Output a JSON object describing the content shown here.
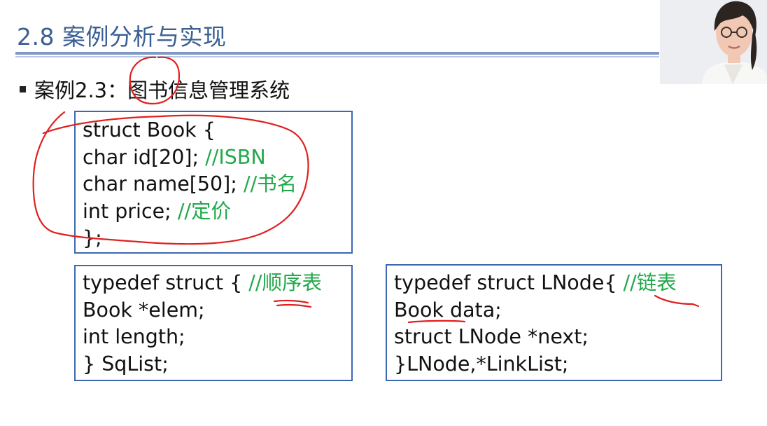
{
  "slide": {
    "title": "2.8 案例分析与实现",
    "bullet": "案例2.3：图书信息管理系统"
  },
  "code_boxes": {
    "book": {
      "lines": [
        {
          "code": "struct Book {",
          "comment": ""
        },
        {
          "code": "  char id[20];  ",
          "comment": "//ISBN"
        },
        {
          "code": "  char name[50];  ",
          "comment": "//书名"
        },
        {
          "code": "  int price;  ",
          "comment": "//定价"
        },
        {
          "code": "};",
          "comment": ""
        }
      ]
    },
    "sqlist": {
      "lines": [
        {
          "code": "typedef struct { ",
          "comment": "//顺序表"
        },
        {
          "code": "   Book *elem;",
          "comment": ""
        },
        {
          "code": "   int length;",
          "comment": ""
        },
        {
          "code": "} SqList;",
          "comment": ""
        }
      ]
    },
    "lnode": {
      "lines": [
        {
          "code": "typedef struct  LNode{ ",
          "comment": "//链表"
        },
        {
          "code": "   Book  data;",
          "comment": ""
        },
        {
          "code": "   struct LNode  *next;",
          "comment": ""
        },
        {
          "code": "}LNode,*LinkList;",
          "comment": ""
        }
      ]
    }
  },
  "colors": {
    "title": "#3a5f94",
    "box_border": "#3c68b3",
    "comment": "#22a94a",
    "annotation_ink": "#e02020"
  }
}
